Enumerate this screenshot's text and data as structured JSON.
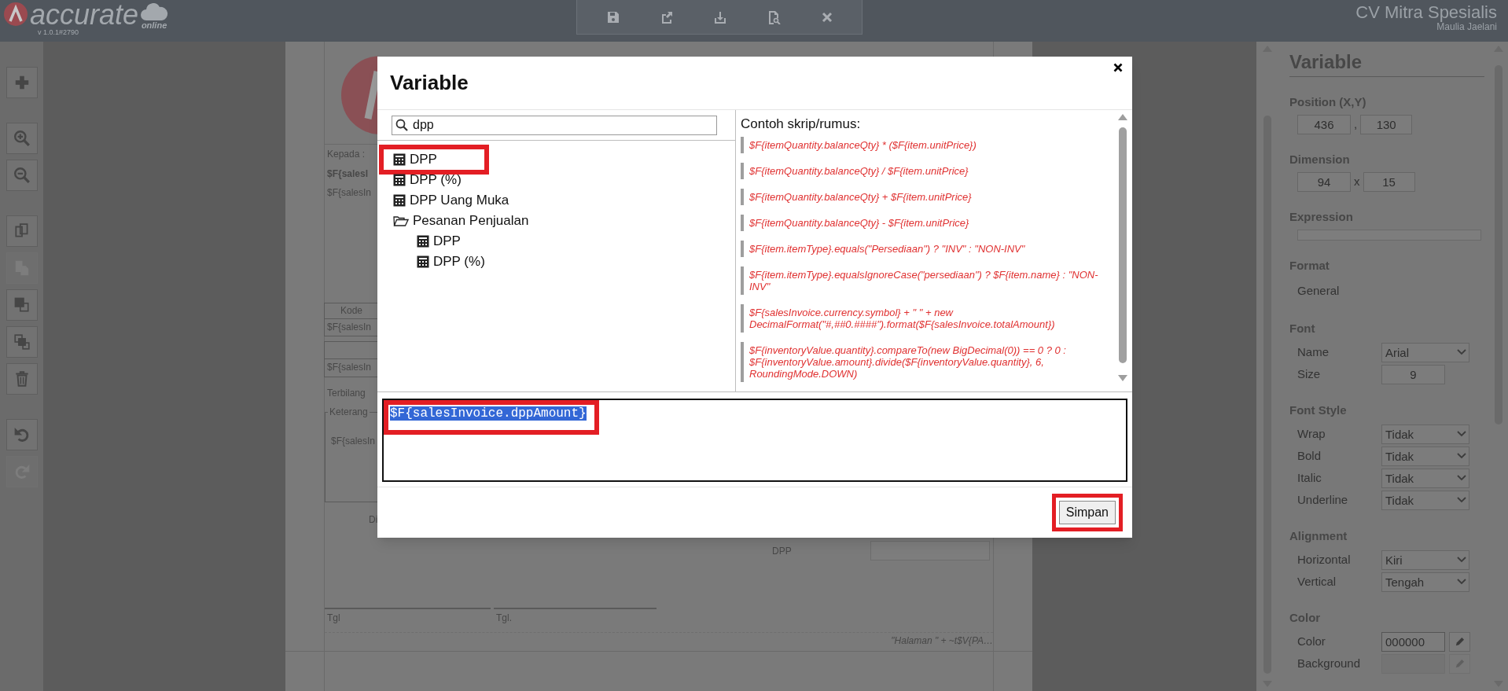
{
  "app": {
    "logo": "accurate",
    "logo_sub": "online",
    "version": "v 1.0.1#2790",
    "company": "CV Mitra Spesialis",
    "user": "Maulia Jaelani"
  },
  "left_tools": [
    {
      "kind": "add",
      "disabled": false
    },
    {
      "kind": "zoom_in",
      "disabled": false
    },
    {
      "kind": "zoom_out",
      "disabled": false
    },
    {
      "kind": "copy",
      "disabled": false
    },
    {
      "kind": "paste",
      "disabled": true
    },
    {
      "kind": "bring_front",
      "disabled": false
    },
    {
      "kind": "send_back",
      "disabled": false
    },
    {
      "kind": "delete",
      "disabled": false
    },
    {
      "kind": "undo",
      "disabled": false
    },
    {
      "kind": "redo",
      "disabled": true
    }
  ],
  "document": {
    "recipient_label": "Kepada :",
    "recipient_name": "$F{salesI",
    "recipient_detail": "$F{salesIn",
    "table_header": "Kode",
    "table_cell": "$F{salesIn",
    "summary_cell": "$F{salesIn",
    "amount_words_label": "Terbilang",
    "notes_label": "Keterang",
    "notes_value": "$F{salesIn",
    "signature_label": "Di",
    "dpp_label": "DPP",
    "date_labels": [
      "Tgl",
      "Tgl."
    ],
    "page_number": "\"Halaman \" +  ~t$V{PA…"
  },
  "dialog": {
    "title": "Variable",
    "search": {
      "value": "dpp"
    },
    "tree": [
      {
        "label": "DPP",
        "kind": "field",
        "highlighted": true
      },
      {
        "label": "DPP (%)",
        "kind": "field",
        "highlighted": false
      },
      {
        "label": "DPP Uang Muka",
        "kind": "field",
        "highlighted": false
      },
      {
        "label": "Pesanan Penjualan",
        "kind": "folder",
        "expanded": true,
        "highlighted": false,
        "children": [
          {
            "label": "DPP",
            "kind": "field",
            "highlighted": false
          },
          {
            "label": "DPP (%)",
            "kind": "field",
            "highlighted": false
          }
        ]
      }
    ],
    "examples_title": "Contoh skrip/rumus:",
    "examples": [
      "$F{itemQuantity.balanceQty} * ($F{item.unitPrice})",
      "$F{itemQuantity.balanceQty} / $F{item.unitPrice}",
      "$F{itemQuantity.balanceQty} + $F{item.unitPrice}",
      "$F{itemQuantity.balanceQty} - $F{item.unitPrice}",
      "$F{item.itemType}.equals(\"Persediaan\") ? \"INV\" : \"NON-INV\"",
      "$F{item.itemType}.equalsIgnoreCase(\"persediaan\") ? $F{item.name} : \"NON-INV\"",
      "$F{salesInvoice.currency.symbol} + \" \" + new DecimalFormat(\"#,##0.####\").format($F{salesInvoice.totalAmount})",
      "$F{inventoryValue.quantity}.compareTo(new BigDecimal(0)) == 0 ? 0 : $F{inventoryValue.amount}.divide($F{inventoryValue.quantity}, 6, RoundingMode.DOWN)"
    ],
    "expression": {
      "value": "$F{salesInvoice.dppAmount}",
      "selected": true,
      "highlighted": true
    },
    "save_button": {
      "label": "Simpan",
      "highlighted": true
    }
  },
  "properties": {
    "title": "Variable",
    "sections": [
      {
        "title": "Position (X,Y)",
        "kind": "pair",
        "values": [
          "436",
          "130"
        ],
        "separator": ","
      },
      {
        "title": "Dimension",
        "kind": "pair",
        "values": [
          "94",
          "15"
        ],
        "separator": "x"
      },
      {
        "title": "Expression",
        "kind": "text_field"
      },
      {
        "title": "Format",
        "kind": "text",
        "value": "General"
      },
      {
        "title": "Font",
        "kind": "rows",
        "rows": [
          {
            "label": "Name",
            "kind": "select",
            "value": "Arial"
          },
          {
            "label": "Size",
            "kind": "number",
            "value": "9"
          }
        ]
      },
      {
        "title": "Font Style",
        "kind": "rows",
        "rows": [
          {
            "label": "Wrap",
            "kind": "select",
            "value": "Tidak"
          },
          {
            "label": "Bold",
            "kind": "select",
            "value": "Tidak"
          },
          {
            "label": "Italic",
            "kind": "select",
            "value": "Tidak"
          },
          {
            "label": "Underline",
            "kind": "select",
            "value": "Tidak"
          }
        ]
      },
      {
        "title": "Alignment",
        "kind": "rows",
        "rows": [
          {
            "label": "Horizontal",
            "kind": "select",
            "value": "Kiri"
          },
          {
            "label": "Vertical",
            "kind": "select",
            "value": "Tengah"
          }
        ]
      },
      {
        "title": "Color",
        "kind": "rows",
        "rows": [
          {
            "label": "Color",
            "kind": "color",
            "value": "000000",
            "disabled": false
          },
          {
            "label": "Background",
            "kind": "color",
            "disabled": true
          }
        ]
      }
    ]
  }
}
